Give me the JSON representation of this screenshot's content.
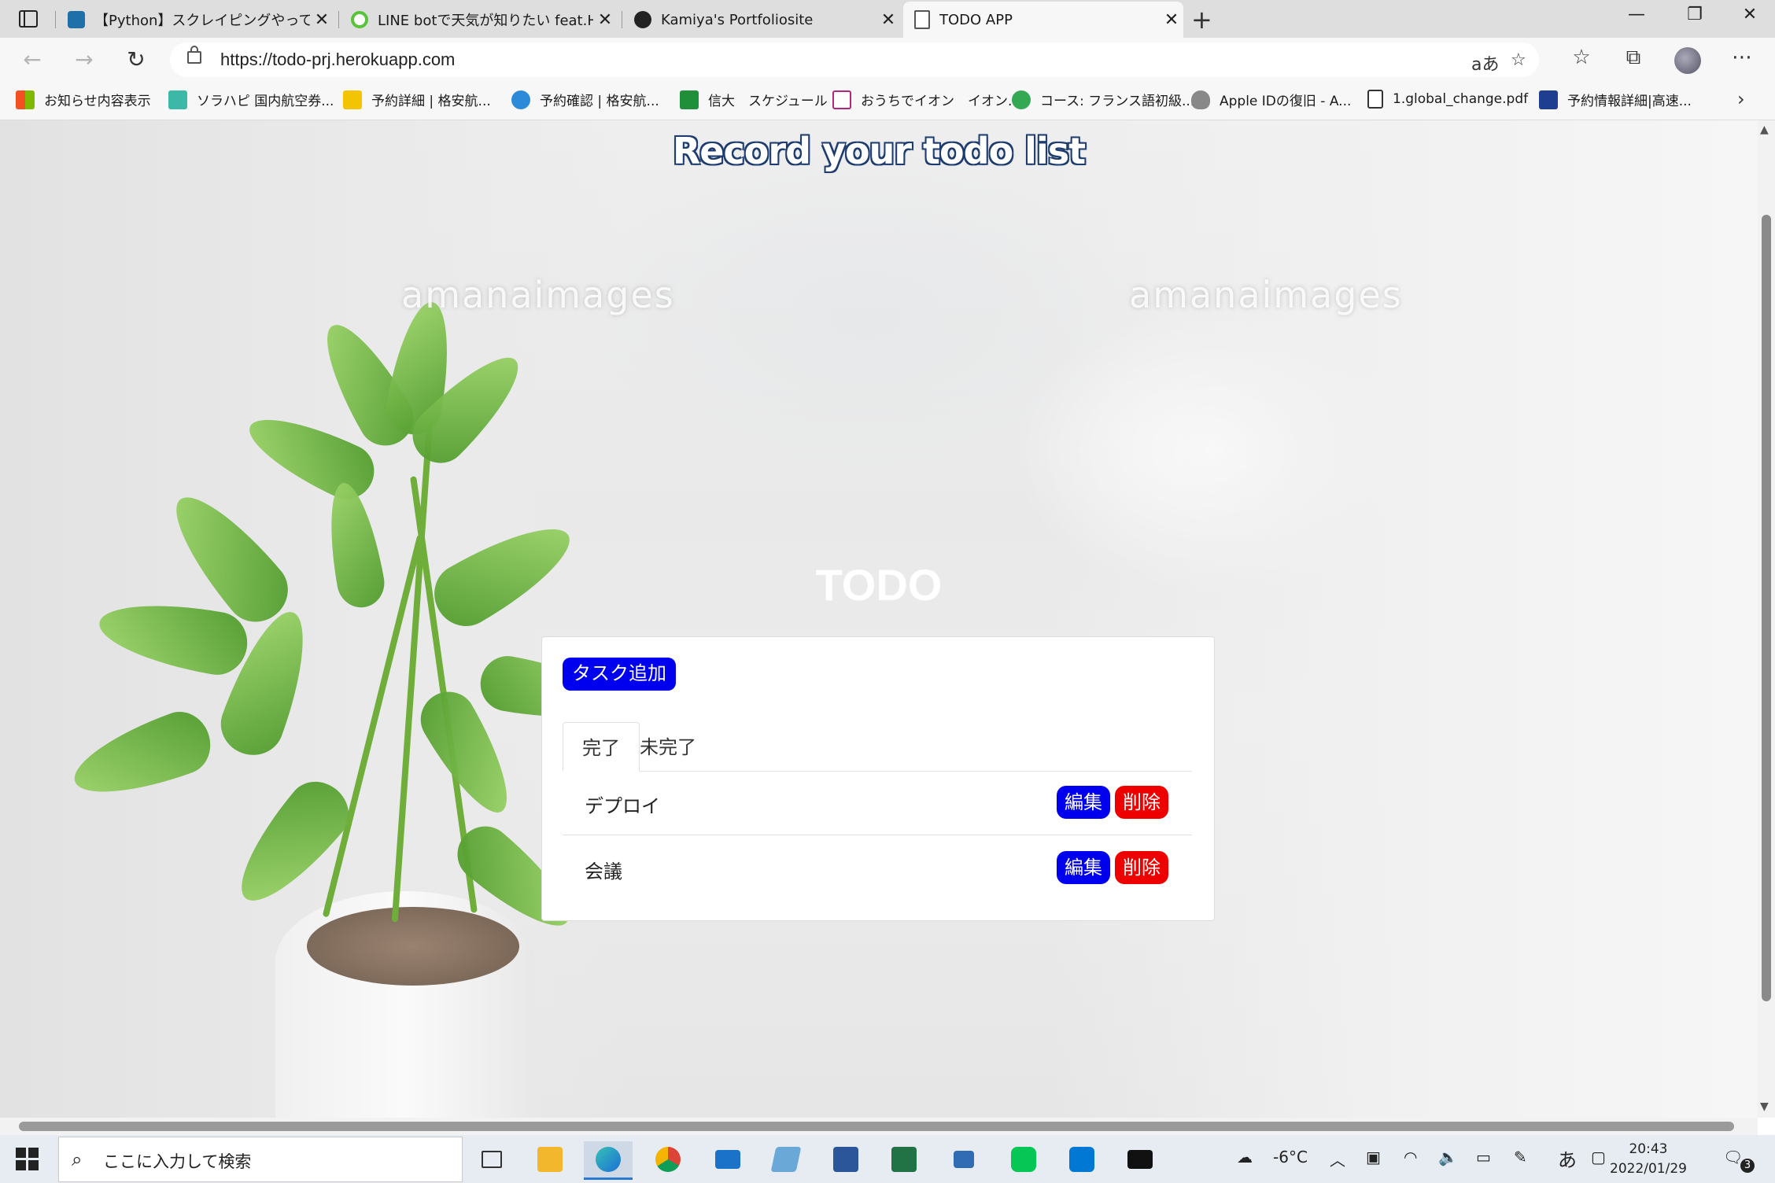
{
  "browser": {
    "tabs": [
      {
        "title": "【Python】スクレイピングやってみた | F",
        "favicon": "blog-icon",
        "color": "#1f6fa8"
      },
      {
        "title": "LINE botで天気が知りたい feat.Her",
        "favicon": "spinner-icon",
        "color": "#57c43a"
      },
      {
        "title": "Kamiya's Portfoliosite",
        "favicon": "avatar-icon",
        "color": "#222222"
      },
      {
        "title": "TODO APP",
        "favicon": "page-icon",
        "color": "#555555",
        "active": true
      }
    ],
    "url": "https://todo-prj.herokuapp.com",
    "read_aloud_label": "aあ",
    "bookmarks": [
      {
        "label": "お知らせ内容表示",
        "color": "#f25022"
      },
      {
        "label": "ソラハピ 国内航空券...",
        "color": "#3cb8a6"
      },
      {
        "label": "予約詳細 | 格安航...",
        "color": "#f5c400"
      },
      {
        "label": "予約確認 | 格安航...",
        "color": "#2d8ad9"
      },
      {
        "label": "信大　スケジュール",
        "color": "#1f8f3a"
      },
      {
        "label": "おうちでイオン　イオン...",
        "color": "#b0267a"
      },
      {
        "label": "コース: フランス語初級...",
        "color": "#34a853"
      },
      {
        "label": "Apple IDの復旧 - A...",
        "color": "#888888"
      },
      {
        "label": "1.global_change.pdf",
        "color": "#ffffff"
      },
      {
        "label": "予約情報詳細|高速...",
        "color": "#1e3f8f"
      }
    ]
  },
  "page": {
    "header": "Record your todo list",
    "watermark": "amanaimages",
    "title": "TODO",
    "add_button": "タスク追加",
    "tabs": [
      {
        "label": "完了",
        "active": true
      },
      {
        "label": "未完了",
        "active": false
      }
    ],
    "tasks": [
      {
        "name": "デプロイ",
        "edit": "編集",
        "delete": "削除"
      },
      {
        "name": "会議",
        "edit": "編集",
        "delete": "削除"
      }
    ],
    "colors": {
      "primary": "#0000ee",
      "danger": "#ee0000",
      "header_outline": "#1e3c6e"
    }
  },
  "taskbar": {
    "search_placeholder": "ここに入力して検索",
    "weather": "-6°C",
    "ime": "あ",
    "time": "20:43",
    "date": "2022/01/29",
    "notifications": "3",
    "apps": [
      {
        "name": "task-view-icon",
        "color": "#333333"
      },
      {
        "name": "file-explorer-icon",
        "color": "#f3b72e"
      },
      {
        "name": "edge-icon",
        "color": "#1c8bd6",
        "active": true
      },
      {
        "name": "chrome-icon",
        "color": "#db4437"
      },
      {
        "name": "mail-icon",
        "color": "#1a73c8"
      },
      {
        "name": "notepad-icon",
        "color": "#6aa8d8"
      },
      {
        "name": "word-icon",
        "color": "#2b579a"
      },
      {
        "name": "excel-icon",
        "color": "#217346"
      },
      {
        "name": "network-icon",
        "color": "#2f6cb3"
      },
      {
        "name": "line-icon",
        "color": "#06c755"
      },
      {
        "name": "vscode-icon",
        "color": "#0078d4"
      },
      {
        "name": "terminal-icon",
        "color": "#111111"
      }
    ]
  }
}
